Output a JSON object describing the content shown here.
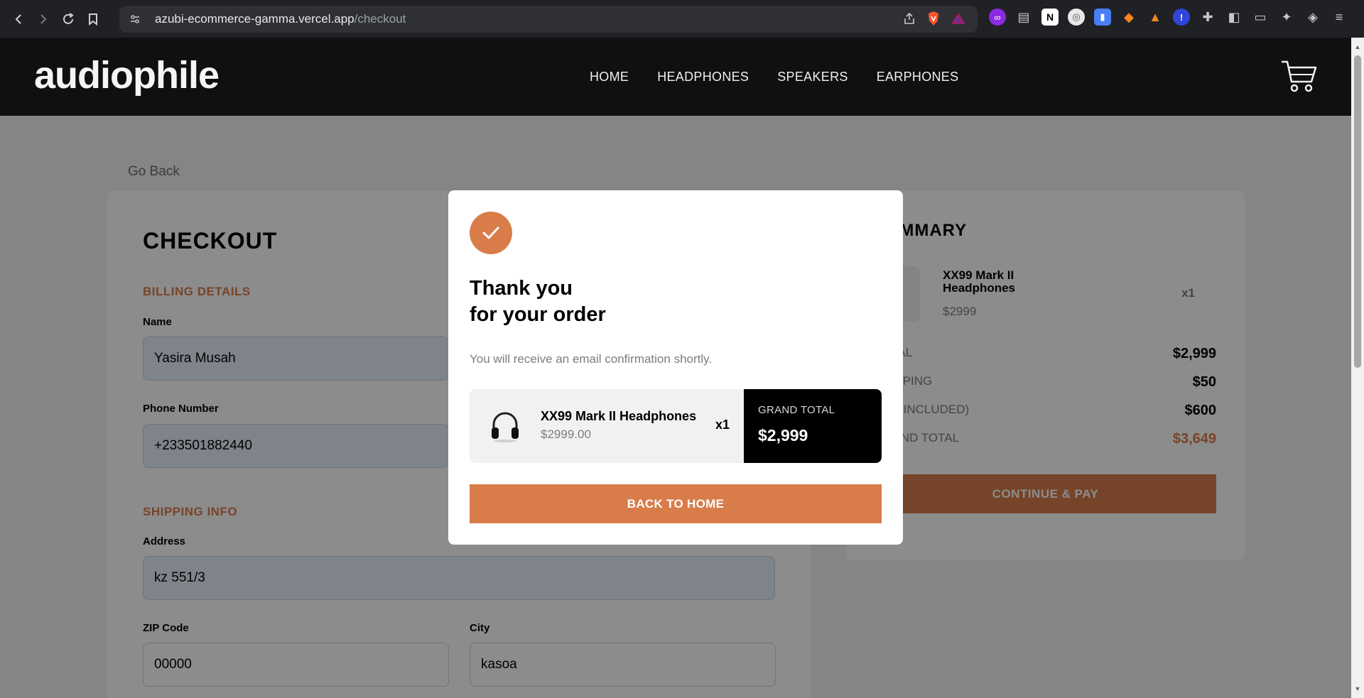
{
  "browser": {
    "url_host": "azubi-ecommerce-gamma.vercel.app",
    "url_path": "/checkout"
  },
  "header": {
    "logo": "audiophile",
    "nav": [
      "HOME",
      "HEADPHONES",
      "SPEAKERS",
      "EARPHONES"
    ]
  },
  "page": {
    "go_back": "Go Back",
    "checkout_title": "CHECKOUT",
    "billing_label": "BILLING DETAILS",
    "name_label": "Name",
    "name_value": "Yasira Musah",
    "phone_label": "Phone Number",
    "phone_value": "+233501882440",
    "shipping_label": "SHIPPING INFO",
    "address_label": "Address",
    "address_value": "kz 551/3",
    "zip_label": "ZIP Code",
    "zip_value": "00000",
    "city_label": "City",
    "city_value": "kasoa"
  },
  "summary": {
    "title": "SUMMARY",
    "item_name": "XX99 Mark II Headphones",
    "item_price": "$2999",
    "item_qty": "x1",
    "rows": [
      {
        "label": "TOTAL",
        "value": "$2,999"
      },
      {
        "label": "SHIPPING",
        "value": "$50"
      },
      {
        "label": "VAT (INCLUDED)",
        "value": "$600"
      },
      {
        "label": "GRAND TOTAL",
        "value": "$3,649"
      }
    ],
    "continue": "CONTINUE & PAY"
  },
  "modal": {
    "title_line1": "Thank you",
    "title_line2": "for your order",
    "confirmation": "You will receive an email confirmation shortly.",
    "item_name": "XX99 Mark II Headphones",
    "item_price": "$2999.00",
    "item_qty": "x1",
    "grand_total_label": "GRAND TOTAL",
    "grand_total_value": "$2,999",
    "back_home": "BACK TO HOME"
  },
  "colors": {
    "accent": "#d87d4a",
    "header_bg": "#101010"
  }
}
